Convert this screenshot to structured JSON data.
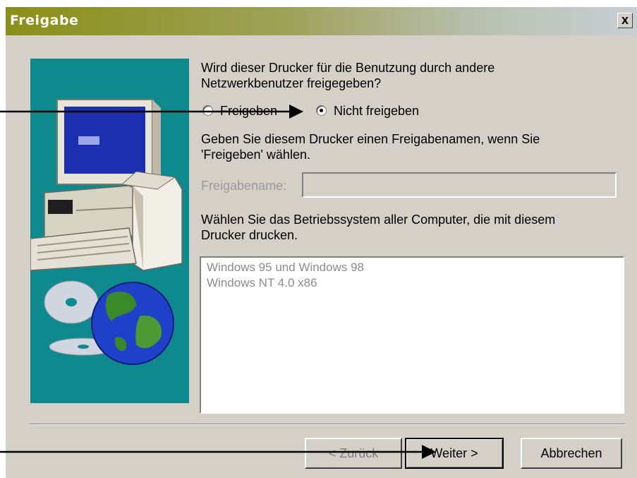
{
  "window": {
    "title": "Freigabe",
    "close_label": "x"
  },
  "question": {
    "line1": "Wird dieser Drucker für die Benutzung durch andere",
    "line2": "Netzwerkbenutzer freigegeben?"
  },
  "share_options": [
    {
      "label": "Freigeben",
      "selected": false
    },
    {
      "label": "Nicht freigeben",
      "selected": true
    }
  ],
  "share_hint": {
    "line1": "Geben Sie diesem Drucker einen Freigabenamen, wenn Sie",
    "line2": "'Freigeben' wählen."
  },
  "share_name": {
    "label": "Freigabename:",
    "value": ""
  },
  "os_prompt": {
    "line1": "Wählen Sie das Betriebssystem aller Computer, die mit diesem",
    "line2": "Drucker drucken."
  },
  "os_list": [
    "Windows 95 und Windows 98",
    "Windows NT 4.0 x86"
  ],
  "buttons": {
    "back": "< Zurück",
    "next": "Weiter >",
    "cancel": "Abbrechen"
  },
  "colors": {
    "panel": "#0e8a8e",
    "dialog": "#d4d0c8"
  }
}
